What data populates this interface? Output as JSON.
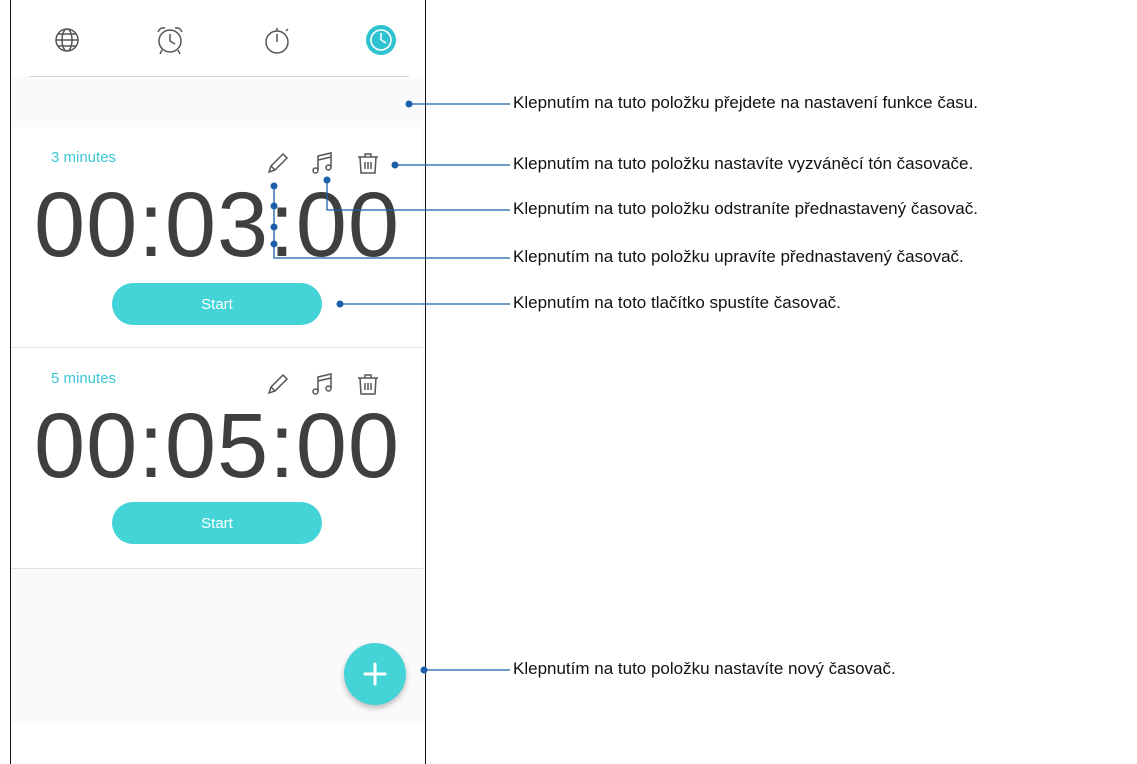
{
  "tabs": [
    {
      "icon": "globe-icon",
      "active": false
    },
    {
      "icon": "alarm-clock-icon",
      "active": false
    },
    {
      "icon": "stopwatch-icon",
      "active": false
    },
    {
      "icon": "timer-icon",
      "active": true
    }
  ],
  "timers": [
    {
      "name": "3 minutes",
      "time": "00:03:00",
      "start_label": "Start"
    },
    {
      "name": "5 minutes",
      "time": "00:05:00",
      "start_label": "Start"
    }
  ],
  "callouts": {
    "settings": "Klepnutím na tuto položku přejdete na nastavení funkce času.",
    "ringtone": "Klepnutím na tuto položku nastavíte vyzváněcí tón časovače.",
    "delete": "Klepnutím na tuto položku odstraníte přednastavený časovač.",
    "edit": "Klepnutím na tuto položku upravíte přednastavený časovač.",
    "start": "Klepnutím na toto tlačítko spustíte časovač.",
    "add": "Klepnutím na tuto položku nastavíte nový časovač."
  },
  "colors": {
    "accent": "#44d4d8",
    "callout_line": "#1b5fa8",
    "text": "#3f3f3f"
  }
}
